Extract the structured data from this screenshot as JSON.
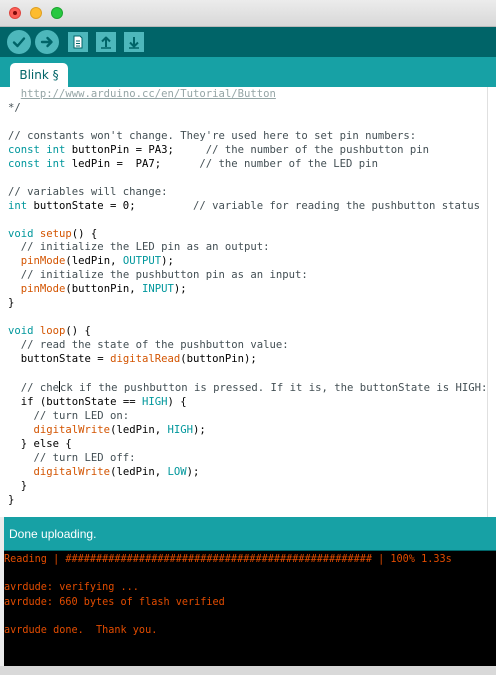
{
  "window": {
    "controls": [
      "close",
      "minimize",
      "zoom"
    ]
  },
  "toolbar": {
    "buttons": [
      "verify",
      "upload",
      "new",
      "open",
      "save"
    ],
    "icons": [
      "check-icon",
      "arrow-right-icon",
      "file-icon",
      "arrow-up-icon",
      "arrow-down-icon"
    ]
  },
  "tab": {
    "label": "Blink §"
  },
  "editor": {
    "lines": [
      [
        {
          "t": "  ",
          "c": "plain"
        },
        {
          "t": "http://www.arduino.cc/en/Tutorial/Button",
          "c": "url"
        }
      ],
      [
        {
          "t": "*/",
          "c": "comment"
        }
      ],
      [],
      [
        {
          "t": "// constants won't change. They're used here to set pin numbers:",
          "c": "comment"
        }
      ],
      [
        {
          "t": "const",
          "c": "type"
        },
        {
          "t": " ",
          "c": "plain"
        },
        {
          "t": "int",
          "c": "type"
        },
        {
          "t": " buttonPin = PA3;     ",
          "c": "plain"
        },
        {
          "t": "// the number of the pushbutton pin",
          "c": "comment"
        }
      ],
      [
        {
          "t": "const",
          "c": "type"
        },
        {
          "t": " ",
          "c": "plain"
        },
        {
          "t": "int",
          "c": "type"
        },
        {
          "t": " ledPin =  PA7;      ",
          "c": "plain"
        },
        {
          "t": "// the number of the LED pin",
          "c": "comment"
        }
      ],
      [],
      [
        {
          "t": "// variables will change:",
          "c": "comment"
        }
      ],
      [
        {
          "t": "int",
          "c": "type"
        },
        {
          "t": " buttonState = 0;         ",
          "c": "plain"
        },
        {
          "t": "// variable for reading the pushbutton status",
          "c": "comment"
        }
      ],
      [],
      [
        {
          "t": "void",
          "c": "type"
        },
        {
          "t": " ",
          "c": "plain"
        },
        {
          "t": "setup",
          "c": "func"
        },
        {
          "t": "() {",
          "c": "plain"
        }
      ],
      [
        {
          "t": "  ",
          "c": "plain"
        },
        {
          "t": "// initialize the LED pin as an output:",
          "c": "comment"
        }
      ],
      [
        {
          "t": "  ",
          "c": "plain"
        },
        {
          "t": "pinMode",
          "c": "func"
        },
        {
          "t": "(ledPin, ",
          "c": "plain"
        },
        {
          "t": "OUTPUT",
          "c": "const"
        },
        {
          "t": ");",
          "c": "plain"
        }
      ],
      [
        {
          "t": "  ",
          "c": "plain"
        },
        {
          "t": "// initialize the pushbutton pin as an input:",
          "c": "comment"
        }
      ],
      [
        {
          "t": "  ",
          "c": "plain"
        },
        {
          "t": "pinMode",
          "c": "func"
        },
        {
          "t": "(buttonPin, ",
          "c": "plain"
        },
        {
          "t": "INPUT",
          "c": "const"
        },
        {
          "t": ");",
          "c": "plain"
        }
      ],
      [
        {
          "t": "}",
          "c": "plain"
        }
      ],
      [],
      [
        {
          "t": "void",
          "c": "type"
        },
        {
          "t": " ",
          "c": "plain"
        },
        {
          "t": "loop",
          "c": "func"
        },
        {
          "t": "() {",
          "c": "plain"
        }
      ],
      [
        {
          "t": "  ",
          "c": "plain"
        },
        {
          "t": "// read the state of the pushbutton value:",
          "c": "comment"
        }
      ],
      [
        {
          "t": "  buttonState = ",
          "c": "plain"
        },
        {
          "t": "digitalRead",
          "c": "func"
        },
        {
          "t": "(buttonPin);",
          "c": "plain"
        }
      ],
      [],
      [
        {
          "t": "  ",
          "c": "plain"
        },
        {
          "t": "// che",
          "c": "comment"
        },
        {
          "t": "",
          "c": "cursor"
        },
        {
          "t": "ck if the pushbutton is pressed. If it is, the buttonState is HIGH:",
          "c": "comment"
        }
      ],
      [
        {
          "t": "  ",
          "c": "plain"
        },
        {
          "t": "if",
          "c": "plain"
        },
        {
          "t": " (buttonState == ",
          "c": "plain"
        },
        {
          "t": "HIGH",
          "c": "const"
        },
        {
          "t": ") {",
          "c": "plain"
        }
      ],
      [
        {
          "t": "    ",
          "c": "plain"
        },
        {
          "t": "// turn LED on:",
          "c": "comment"
        }
      ],
      [
        {
          "t": "    ",
          "c": "plain"
        },
        {
          "t": "digitalWrite",
          "c": "func"
        },
        {
          "t": "(ledPin, ",
          "c": "plain"
        },
        {
          "t": "HIGH",
          "c": "const"
        },
        {
          "t": ");",
          "c": "plain"
        }
      ],
      [
        {
          "t": "  } ",
          "c": "plain"
        },
        {
          "t": "else",
          "c": "plain"
        },
        {
          "t": " {",
          "c": "plain"
        }
      ],
      [
        {
          "t": "    ",
          "c": "plain"
        },
        {
          "t": "// turn LED off:",
          "c": "comment"
        }
      ],
      [
        {
          "t": "    ",
          "c": "plain"
        },
        {
          "t": "digitalWrite",
          "c": "func"
        },
        {
          "t": "(ledPin, ",
          "c": "plain"
        },
        {
          "t": "LOW",
          "c": "const"
        },
        {
          "t": ");",
          "c": "plain"
        }
      ],
      [
        {
          "t": "  }",
          "c": "plain"
        }
      ],
      [
        {
          "t": "}",
          "c": "plain"
        }
      ]
    ]
  },
  "status": {
    "message": "Done uploading."
  },
  "console": {
    "lines": [
      "Reading | ################################################## | 100% 1.33s",
      "",
      "avrdude: verifying ...",
      "avrdude: 660 bytes of flash verified",
      "",
      "avrdude done.  Thank you."
    ]
  },
  "colors": {
    "toolbar": "#006468",
    "tabstrip": "#17a1a5",
    "button": "#4db7bb",
    "keyword": "#00979c",
    "function": "#d35400",
    "comment": "#434f54",
    "console_text": "#e34c00"
  }
}
